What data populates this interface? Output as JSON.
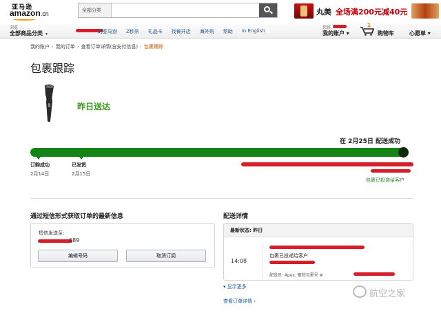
{
  "header": {
    "logo_cn": "亚马逊",
    "logo_main": "amazon",
    "logo_suffix": ".cn",
    "search_category": "全部分类",
    "search_placeholder": "",
    "promo_brand": "丸美",
    "promo_text": "全场满200元减40元"
  },
  "nav": {
    "location_hint": "浏览",
    "all_categories": "全部商品分类",
    "links": [
      "的亚马逊",
      "Z秒杀",
      "礼品卡",
      "找餐开店",
      "海外购",
      "帮助",
      "In English"
    ],
    "account_hello": "您好,",
    "account_label": "我的账户",
    "cart_count": "2",
    "cart_label": "购物车",
    "wishlist_label": "心愿单"
  },
  "breadcrumb": {
    "items": [
      "我的账户",
      "我的订单",
      "查看订单详情(含支付信息)"
    ],
    "current": "包裹跟踪",
    "separator": "›"
  },
  "page": {
    "title": "包裹跟踪",
    "status": "昨日送达"
  },
  "tracking": {
    "delivered_date": "在 2月25日 配送成功",
    "progress_percent": 100,
    "steps": [
      {
        "label": "订购成功",
        "date": "2月14日"
      },
      {
        "label": "已发货",
        "date": "2月15日"
      }
    ],
    "delivered_note": "包裹已投递给客户"
  },
  "sms": {
    "title": "通过短信形式获取订单的最新信息",
    "sent_label": "短信发送至:",
    "number_suffix": "689",
    "edit_button": "编辑号码",
    "cancel_button": "取消订阅"
  },
  "details": {
    "title": "配送详情",
    "latest_status": "最新状态: 昨日",
    "time": "14:08",
    "event": "包裹已投递给客户",
    "courier": "配送员:  Apex, 跟踪包裹号 #",
    "show_more": "显示更多",
    "view_order": "查看订单详情 ›"
  },
  "watermark": {
    "text": "航空之家"
  },
  "colors": {
    "progress": "#148514",
    "status_green": "#3b9a1c",
    "link": "#1a5a9a",
    "redaction": "#d61e2b"
  }
}
